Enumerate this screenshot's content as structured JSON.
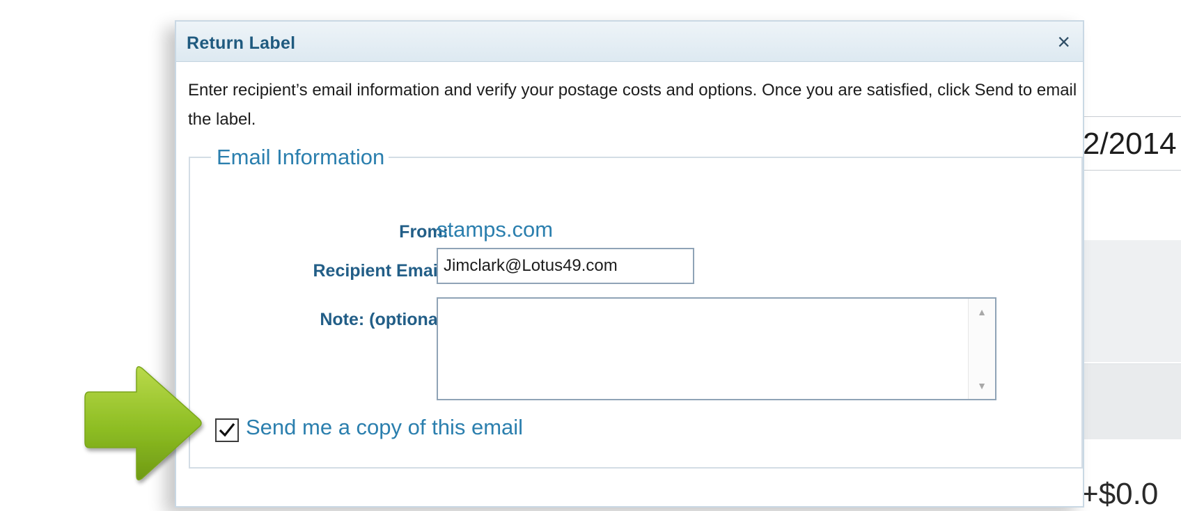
{
  "background": {
    "date_fragment": "2/2014",
    "bottom_fragment": "+$0.0"
  },
  "dialog": {
    "title": "Return Label",
    "close_glyph": "×",
    "intro": "Enter recipient’s email information and verify your postage costs and options. Once you are satisfied, click Send to email the label.",
    "email_info": {
      "legend": "Email Information",
      "from_label": "From:",
      "from_value": "stamps.com",
      "recipient_label": "Recipient Email:",
      "recipient_value": "Jimclark@Lotus49.com",
      "note_label": "Note: (optional)",
      "note_value": "",
      "copy_label": "Send me a copy of this email",
      "copy_checked": true
    }
  },
  "annotation": {
    "arrow_color": "#8dbd23"
  }
}
